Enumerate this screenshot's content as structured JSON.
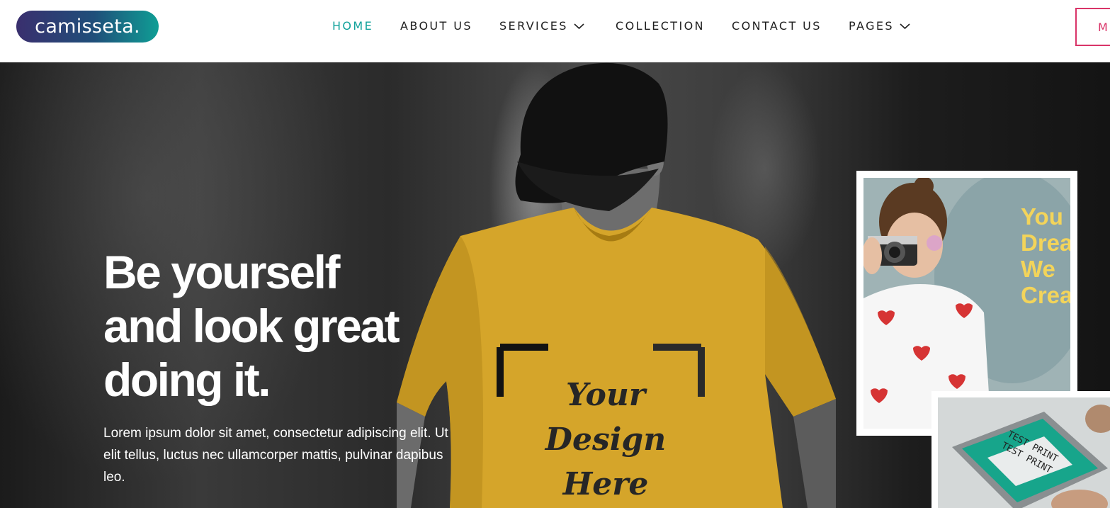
{
  "header": {
    "logo_text": "camisseta.",
    "nav": [
      {
        "label": "HOME",
        "active": true,
        "has_dropdown": false
      },
      {
        "label": "ABOUT US",
        "active": false,
        "has_dropdown": false
      },
      {
        "label": "SERVICES",
        "active": false,
        "has_dropdown": true
      },
      {
        "label": "COLLECTION",
        "active": false,
        "has_dropdown": false
      },
      {
        "label": "CONTACT US",
        "active": false,
        "has_dropdown": false
      },
      {
        "label": "PAGES",
        "active": false,
        "has_dropdown": true
      }
    ],
    "cta_label": "M"
  },
  "hero": {
    "headline": [
      "Be yourself",
      "and look great",
      "doing it."
    ],
    "subtext": "Lorem ipsum dolor sit amet, consectetur adipiscing elit. Ut elit tellus, luctus nec ullamcorper mattis, pulvinar dapibus leo.",
    "shirt_print": [
      "Your",
      "Design",
      "Here"
    ],
    "card1_text": [
      "You",
      "Dream I",
      "We",
      "Create I"
    ],
    "card2_print": [
      "TEST PRINT",
      "TEST PRINT"
    ]
  },
  "colors": {
    "accent_teal": "#12a29c",
    "cta_pink": "#d93468",
    "shirt_mustard": "#d5a52a",
    "card_yellow": "#f3d45a"
  }
}
